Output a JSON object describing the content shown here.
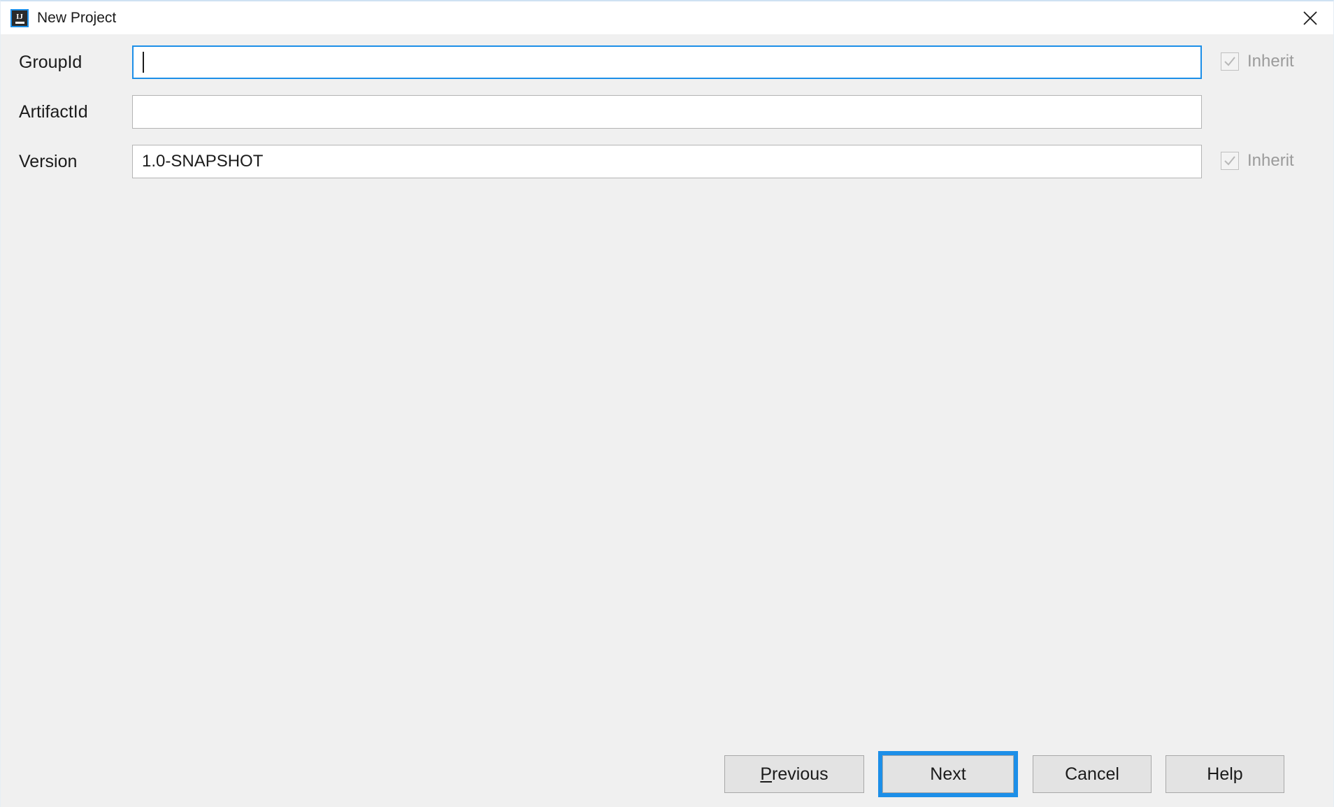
{
  "window": {
    "title": "New Project",
    "icon": "intellij-idea-icon",
    "icon_letters": "IJ",
    "close_label": "Close"
  },
  "accent_color": "#1d8fe8",
  "background_color": "#f0f0f0",
  "titlebar_color": "#ffffff",
  "form": {
    "fields": [
      {
        "label": "GroupId",
        "value": "",
        "placeholder": "",
        "focused": true,
        "has_inherit": true,
        "inherit_label": "Inherit",
        "inherit_checked": true,
        "inherit_disabled": true
      },
      {
        "label": "ArtifactId",
        "value": "",
        "placeholder": "",
        "focused": false,
        "has_inherit": false,
        "inherit_label": "",
        "inherit_checked": false,
        "inherit_disabled": false
      },
      {
        "label": "Version",
        "value": "1.0-SNAPSHOT",
        "placeholder": "",
        "focused": false,
        "has_inherit": true,
        "inherit_label": "Inherit",
        "inherit_checked": true,
        "inherit_disabled": true
      }
    ]
  },
  "buttons": {
    "previous": {
      "mnemonic": "P",
      "rest": "revious"
    },
    "next": "Next",
    "cancel": "Cancel",
    "help": "Help"
  }
}
